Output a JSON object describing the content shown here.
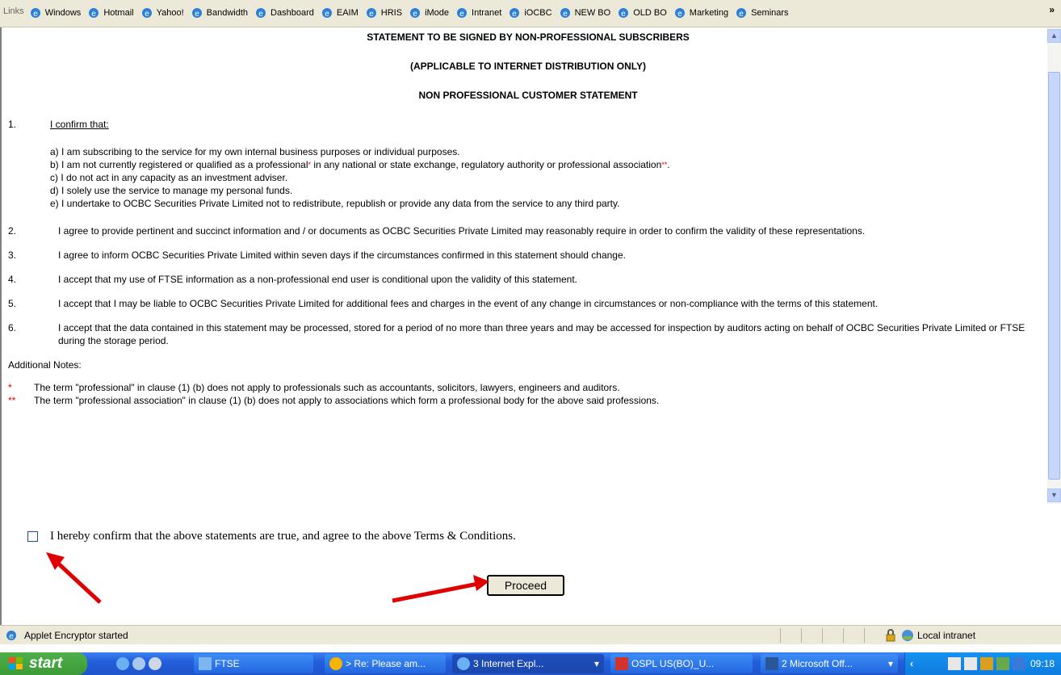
{
  "links_bar": {
    "label": "Links",
    "items": [
      "Windows",
      "Hotmail",
      "Yahoo!",
      "Bandwidth",
      "Dashboard",
      "EAIM",
      "HRIS",
      "iMode",
      "Intranet",
      "iOCBC",
      "NEW BO",
      "OLD BO",
      "Marketing",
      "Seminars"
    ],
    "overflow": "»"
  },
  "document": {
    "heading1": "STATEMENT TO BE SIGNED BY NON-PROFESSIONAL SUBSCRIBERS",
    "heading2": "(APPLICABLE TO INTERNET DISTRIBUTION ONLY)",
    "heading3": "NON PROFESSIONAL CUSTOMER STATEMENT",
    "clause1_num": "1.",
    "clause1_title": "I confirm that:",
    "sub_a": "a) I am subscribing to the service for my own internal business purposes or individual purposes.",
    "sub_b_pre": "b) I am not currently registered or qualified as a professional",
    "sub_b_mark1": "*",
    "sub_b_mid": " in any national or state exchange, regulatory authority or professional association",
    "sub_b_mark2": "**",
    "sub_b_end": ".",
    "sub_c": "c) I do not act in any capacity as an investment adviser.",
    "sub_d": "d) I solely use the service to manage my personal funds.",
    "sub_e": "e) I undertake to OCBC Securities Private Limited not to redistribute, republish or provide any data from the service to any third party.",
    "clauses": [
      {
        "num": "2.",
        "text": "I agree to provide pertinent and succinct information and / or documents as OCBC Securities Private Limited may reasonably require in order to confirm the validity of these representations."
      },
      {
        "num": "3.",
        "text": "I agree to inform OCBC Securities Private Limited within seven days if the circumstances confirmed in this statement should change."
      },
      {
        "num": "4.",
        "text": "I accept that my use of FTSE information as a non-professional end user is conditional upon the validity of this statement."
      },
      {
        "num": "5.",
        "text": "I accept that I may be liable to OCBC Securities Private Limited for additional fees and charges in the event of any change in circumstances or non-compliance with the terms of this statement."
      },
      {
        "num": "6.",
        "text": "I accept that the data contained in this statement may be processed, stored for a period of no more than three years and may be accessed for inspection by auditors acting on behalf of OCBC Securities Private Limited or FTSE during the storage period."
      }
    ],
    "notes_label": "Additional Notes:",
    "note1_mark": "*",
    "note1_text": "The term \"professional\" in clause (1) (b) does not apply to professionals such as accountants, solicitors, lawyers, engineers and auditors.",
    "note2_mark": "**",
    "note2_text": "The term \"professional association\" in clause (1) (b) does not apply to associations which form a professional body for the above said professions."
  },
  "confirm": {
    "label": "I hereby confirm that the above statements are true, and agree to the above Terms & Conditions.",
    "checked": false
  },
  "proceed_label": "Proceed",
  "status_bar": {
    "text": "Applet Encryptor started",
    "zone": "Local intranet"
  },
  "taskbar": {
    "start": "start",
    "tasks": [
      "FTSE",
      "> Re: Please am...",
      "3 Internet Expl...",
      "OSPL US(BO)_U...",
      "2 Microsoft Off..."
    ],
    "clock": "09:18"
  },
  "colors": {
    "accent_red": "#e00000",
    "taskbar_blue": "#245edb",
    "start_green": "#3c9a37"
  }
}
